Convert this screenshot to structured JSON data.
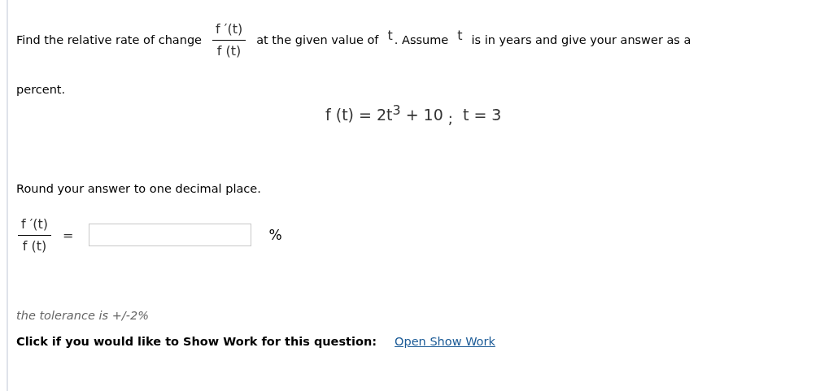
{
  "question": {
    "intro": "Find the relative rate of change",
    "ratio": {
      "numerator": "f ′(t)",
      "denominator": "f (t)"
    },
    "middle": "at the given value of",
    "variable_1": "t",
    "assume": ". Assume",
    "variable_2": "t",
    "rest": "is in years and give your answer as a",
    "end": "percent."
  },
  "equation": {
    "function": "f (t) = 2t$^{3}$ + 10",
    "separator": ";",
    "given": "t = 3"
  },
  "instruction": "Round your answer to one decimal place.",
  "answer": {
    "ratio": {
      "numerator": "f ′(t)",
      "denominator": "f (t)"
    },
    "equals": "=",
    "unit": "%"
  },
  "tolerance": "the tolerance is +/-2%",
  "show_work": {
    "prompt": "Click if you would like to Show Work for this question:",
    "link": "Open Show Work"
  }
}
